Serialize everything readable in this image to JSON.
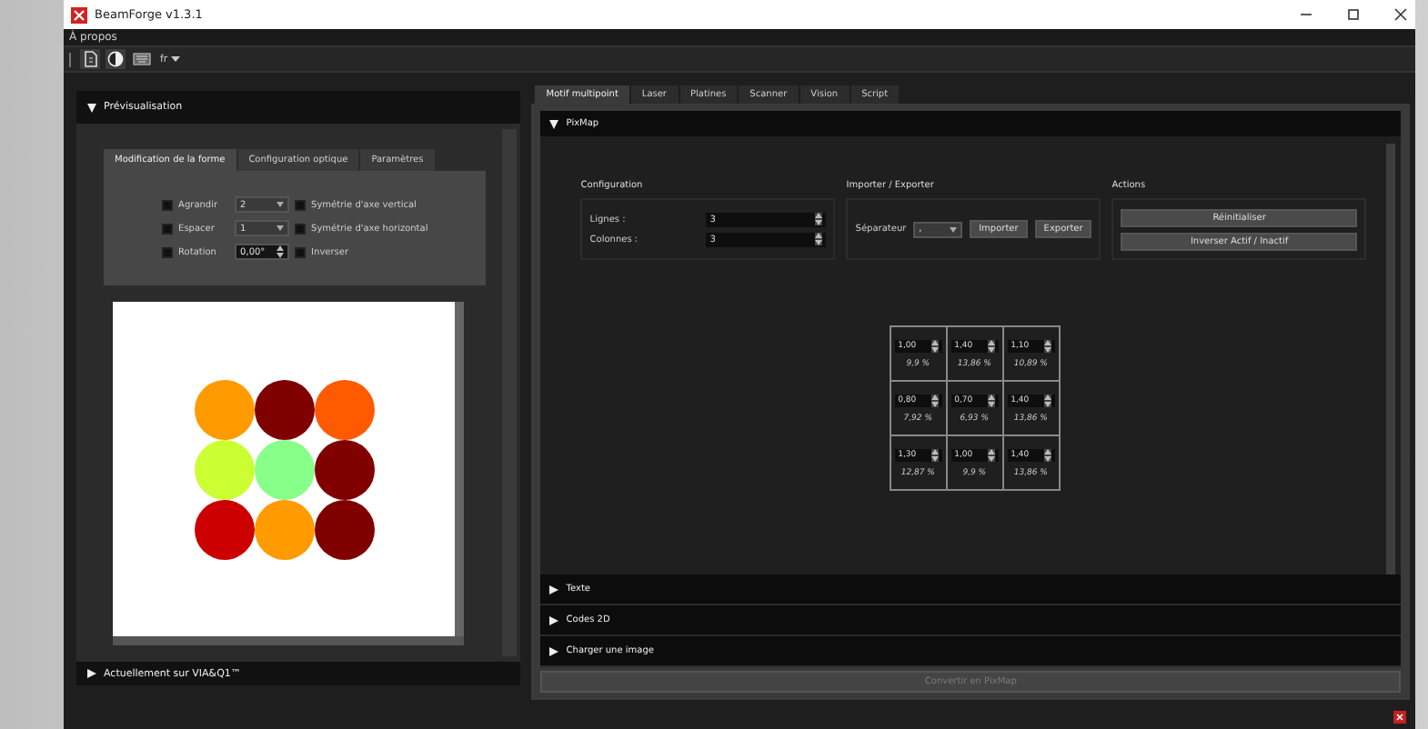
{
  "window": {
    "title": "BeamForge v1.3.1"
  },
  "menu": [
    "À propos"
  ],
  "toolbar": {
    "tools": [
      {
        "kind": "document",
        "selected": true
      },
      {
        "kind": "contrast",
        "selected": true
      },
      {
        "kind": "keyboard",
        "selected": false
      }
    ],
    "language": "fr"
  },
  "preview_panel": {
    "title": "Prévisualisation",
    "expanded": true,
    "tabs": [
      {
        "label": "Modification de la forme",
        "selected": true
      },
      {
        "label": "Configuration optique",
        "selected": false
      },
      {
        "label": "Paramètres",
        "selected": false
      }
    ],
    "options": [
      {
        "kind": "dropdown",
        "label": "Agrandir",
        "checked": false,
        "value": "2"
      },
      {
        "kind": "dropdown",
        "label": "Espacer",
        "checked": false,
        "value": "1"
      },
      {
        "kind": "spinbox",
        "label": "Rotation",
        "checked": false,
        "value": "0,00°"
      }
    ],
    "mirror_options": [
      {
        "label": "Symétrie d'axe vertical",
        "checked": false
      },
      {
        "label": "Symétrie d'axe horizontal",
        "checked": false
      },
      {
        "label": "Inverser",
        "checked": false
      }
    ],
    "dots": [
      {
        "color": "#ff9a00"
      },
      {
        "color": "#800000"
      },
      {
        "color": "#ff5a00"
      },
      {
        "color": "#ccff33"
      },
      {
        "color": "#88ff88"
      },
      {
        "color": "#800000"
      },
      {
        "color": "#cc0000"
      },
      {
        "color": "#ff9a00"
      },
      {
        "color": "#800000"
      }
    ]
  },
  "status_section": {
    "title": "Actuellement sur VIA&Q1™",
    "expanded": false
  },
  "right_tabs": [
    {
      "label": "Motif multipoint",
      "selected": true
    },
    {
      "label": "Laser",
      "selected": false
    },
    {
      "label": "Platines",
      "selected": false
    },
    {
      "label": "Scanner",
      "selected": false
    },
    {
      "label": "Vision",
      "selected": false
    },
    {
      "label": "Script",
      "selected": false
    }
  ],
  "pixmap": {
    "title": "PixMap",
    "expanded": true,
    "configuration": {
      "title": "Configuration",
      "fields": [
        {
          "label": "Lignes :",
          "value": "3"
        },
        {
          "label": "Colonnes :",
          "value": "3"
        }
      ]
    },
    "import_export": {
      "title": "Importer / Exporter",
      "separator_label": "Séparateur",
      "separator_value": ",",
      "buttons": [
        "Importer",
        "Exporter"
      ]
    },
    "actions": {
      "title": "Actions",
      "buttons": [
        "Réinitialiser",
        "Inverser Actif / Inactif"
      ]
    },
    "grid": [
      [
        {
          "value": "1,00",
          "percent": "9,9 %"
        },
        {
          "value": "1,40",
          "percent": "13,86 %"
        },
        {
          "value": "1,10",
          "percent": "10,89 %"
        }
      ],
      [
        {
          "value": "0,80",
          "percent": "7,92 %"
        },
        {
          "value": "0,70",
          "percent": "6,93 %"
        },
        {
          "value": "1,40",
          "percent": "13,86 %"
        }
      ],
      [
        {
          "value": "1,30",
          "percent": "12,87 %"
        },
        {
          "value": "1,00",
          "percent": "9,9 %"
        },
        {
          "value": "1,40",
          "percent": "13,86 %"
        }
      ]
    ]
  },
  "sections": [
    {
      "title": "Texte",
      "expanded": false
    },
    {
      "title": "Codes 2D",
      "expanded": false
    },
    {
      "title": "Charger une image",
      "expanded": false
    }
  ],
  "convert_button": {
    "label": "Convertir en PixMap",
    "disabled": true
  }
}
